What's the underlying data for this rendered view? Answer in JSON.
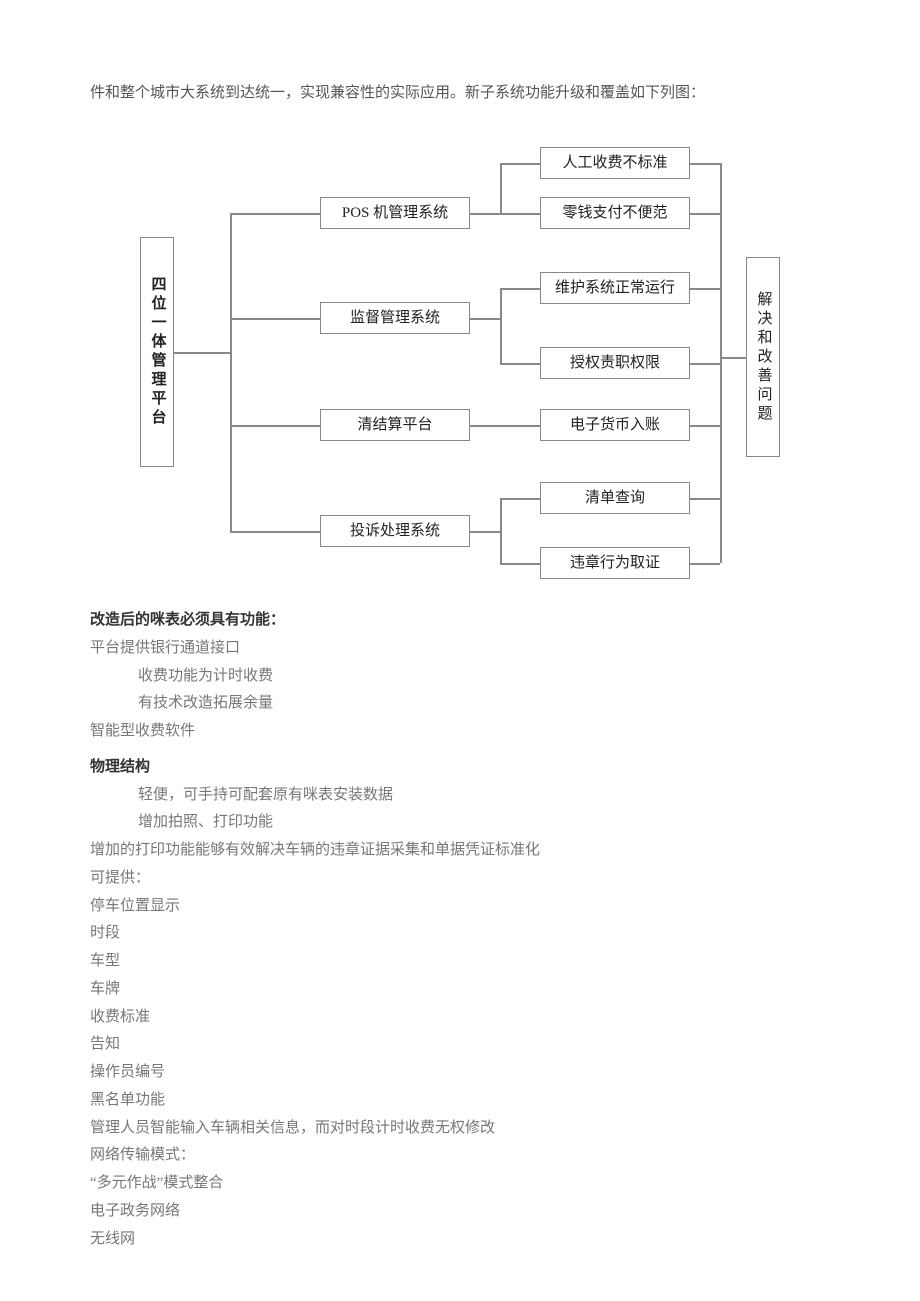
{
  "intro": "件和整个城市大系统到达统一，实现兼容性的实际应用。新子系统功能升级和覆盖如下列图：",
  "diagram": {
    "left": "四位一体管理平台",
    "right": "解决和改善问题",
    "mid": [
      "POS 机管理系统",
      "监督管理系统",
      "清结算平台",
      "投诉处理系统"
    ],
    "leaves": [
      "人工收费不标准",
      "零钱支付不便范",
      "维护系统正常运行",
      "授权责职权限",
      "电子货币入账",
      "清单查询",
      "违章行为取证"
    ]
  },
  "body": {
    "h1": "改造后的咪表必须具有功能：",
    "l1": "平台",
    "l1b": "提供银行通道接口",
    "l2": "收费功能为计时收费",
    "l3": "有技术改造拓展余量",
    "l4": "智能型收费软件",
    "h2": "物理结构",
    "l5": "轻便，可手持可配套原有咪表安装数据",
    "l6": "增加拍照、打印功能",
    "l7": "增加的打印功能能够有效解决车辆的违章证据采集和单据凭证标准化",
    "l8": "可提供：",
    "l9": "停车位置显示",
    "l10": "时段",
    "l11": "车型",
    "l12": "车牌",
    "l13": "收费标准",
    "l14": "告知",
    "l15": "操作员编号",
    "l16": "黑名单功能",
    "l17": "管理人员智能输入车辆相关信息，而对时段计时收费无权修改",
    "l18": "网络传输模式：",
    "l19": "“多元作战”模式整合",
    "l20": "电子政务网络",
    "l21": "无线网"
  }
}
